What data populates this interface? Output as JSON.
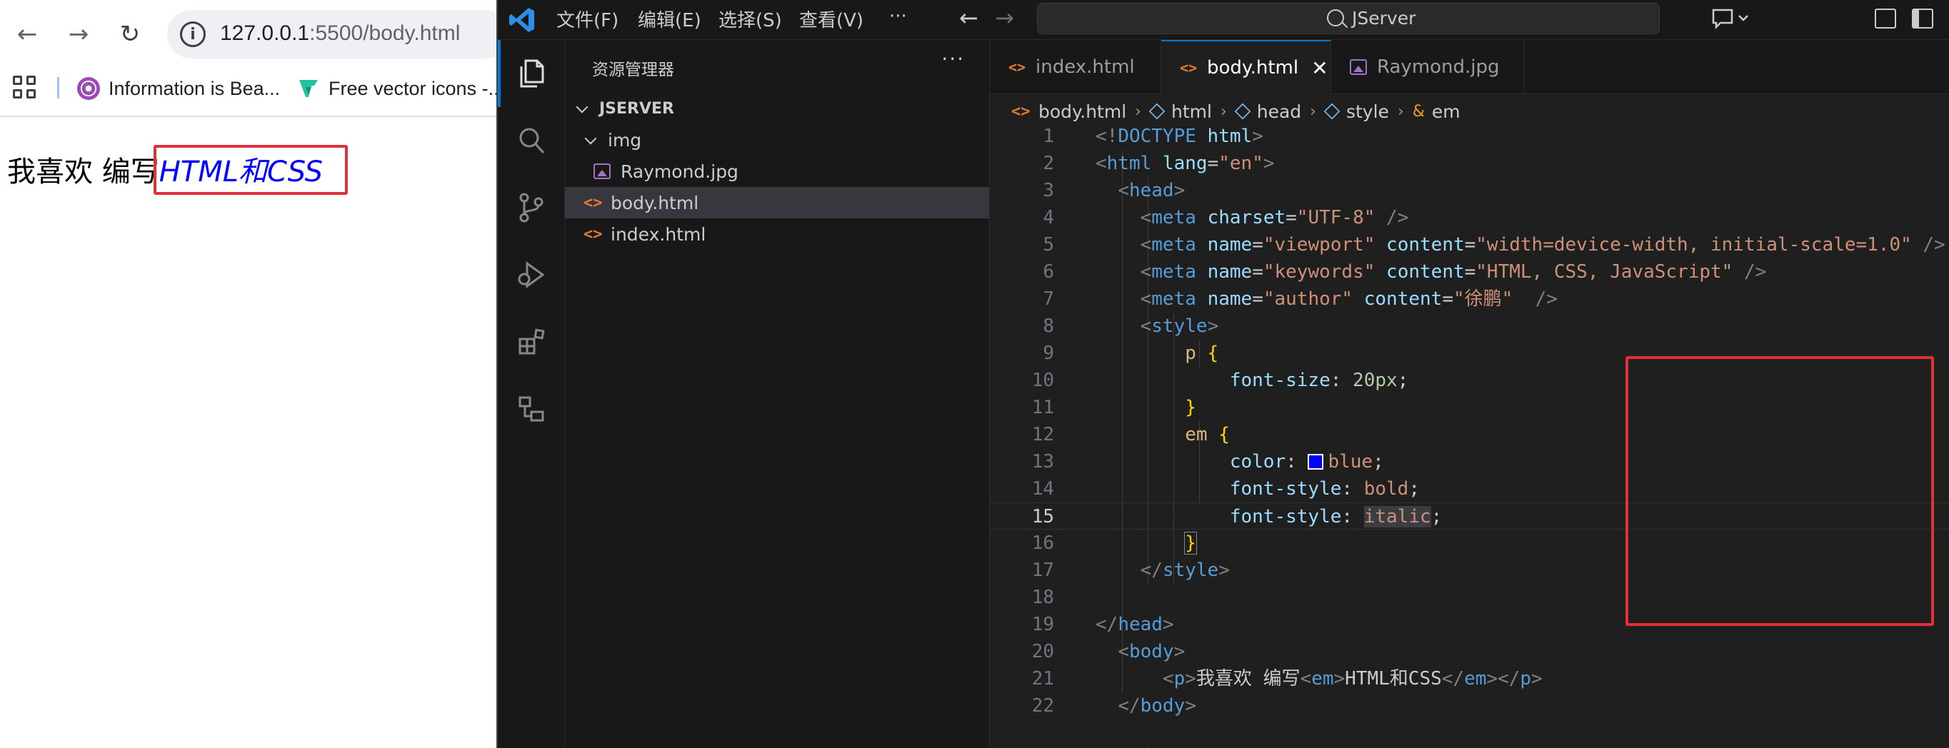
{
  "browser": {
    "url_host": "127.0.0.1",
    "url_path": ":5500/body.html",
    "bookmarks": [
      {
        "label": "Information is Bea..."
      },
      {
        "label": "Free vector icons -..."
      }
    ],
    "page": {
      "text_before": "我喜欢 编写",
      "emphasis": "HTML和CSS"
    }
  },
  "vscode": {
    "menu": [
      "文件(F)",
      "编辑(E)",
      "选择(S)",
      "查看(V)",
      "···"
    ],
    "search_label": "JServer",
    "sidebar": {
      "title": "资源管理器",
      "more": "···",
      "root": "JSERVER",
      "folder": "img",
      "files": [
        "Raymond.jpg",
        "body.html",
        "index.html"
      ]
    },
    "tabs": [
      "index.html",
      "body.html",
      "Raymond.jpg"
    ],
    "tab_close": "✕",
    "breadcrumb": [
      "body.html",
      "html",
      "head",
      "style",
      "em"
    ],
    "line_numbers": [
      "1",
      "2",
      "3",
      "4",
      "5",
      "6",
      "7",
      "8",
      "9",
      "10",
      "11",
      "12",
      "13",
      "14",
      "15",
      "16",
      "17",
      "18",
      "19",
      "20",
      "21",
      "22"
    ],
    "current_line": "15",
    "colors": {
      "accent": "#0078d4",
      "highlight_box": "#e0313b",
      "swatch_blue": "#0000ff"
    }
  }
}
